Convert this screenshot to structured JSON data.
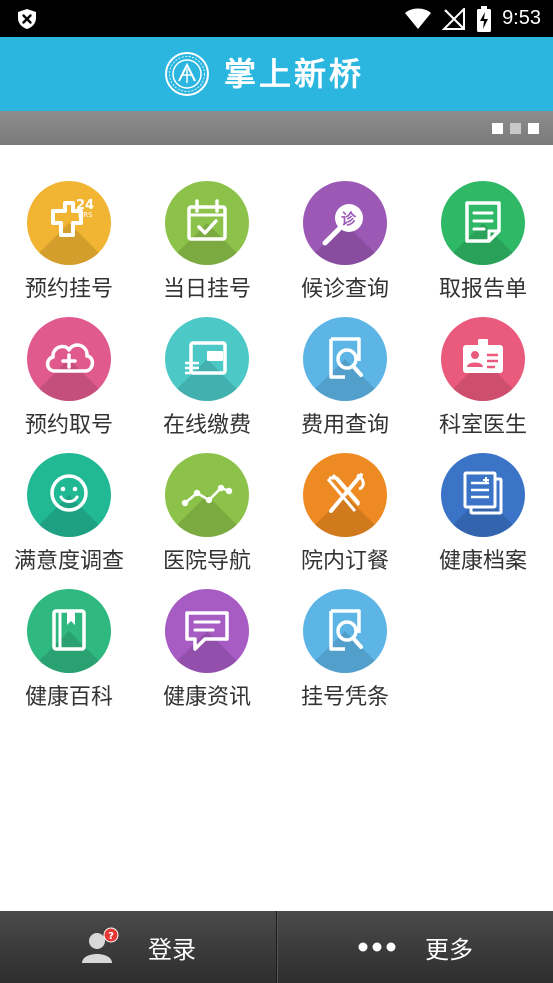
{
  "status_bar": {
    "time": "9:53",
    "icons": [
      "close-shield-icon",
      "wifi-icon",
      "no-signal-icon",
      "battery-charging-icon"
    ]
  },
  "header": {
    "title": "掌上新桥",
    "logo": "hospital-logo"
  },
  "banner": {
    "page_count": 3,
    "active_page": 3
  },
  "menu": {
    "items": [
      {
        "label": "预约挂号",
        "icon": "24hrs-cross-icon",
        "color": "#f2b433"
      },
      {
        "label": "当日挂号",
        "icon": "calendar-check-icon",
        "color": "#8cc24a"
      },
      {
        "label": "候诊查询",
        "icon": "diagnosis-search-icon",
        "color": "#9b58b5"
      },
      {
        "label": "取报告单",
        "icon": "report-document-icon",
        "color": "#2fb866"
      },
      {
        "label": "预约取号",
        "icon": "cloud-add-icon",
        "color": "#e05a8e"
      },
      {
        "label": "在线缴费",
        "icon": "wallet-icon",
        "color": "#4cc9c6"
      },
      {
        "label": "费用查询",
        "icon": "search-document-icon",
        "color": "#5db5e6"
      },
      {
        "label": "科室医生",
        "icon": "doctor-badge-icon",
        "color": "#ea5a7d"
      },
      {
        "label": "满意度调查",
        "icon": "smiley-icon",
        "color": "#21b894"
      },
      {
        "label": "医院导航",
        "icon": "route-line-icon",
        "color": "#8cc24a"
      },
      {
        "label": "院内订餐",
        "icon": "fork-knife-icon",
        "color": "#ee8a22"
      },
      {
        "label": "健康档案",
        "icon": "health-records-icon",
        "color": "#3b73c7"
      },
      {
        "label": "健康百科",
        "icon": "encyclopedia-book-icon",
        "color": "#2fb880"
      },
      {
        "label": "健康资讯",
        "icon": "message-icon",
        "color": "#a75cc4"
      },
      {
        "label": "挂号凭条",
        "icon": "search-document-icon",
        "color": "#5db5e6"
      }
    ]
  },
  "bottom_bar": {
    "login_label": "登录",
    "more_label": "更多",
    "login_badge": "?"
  }
}
